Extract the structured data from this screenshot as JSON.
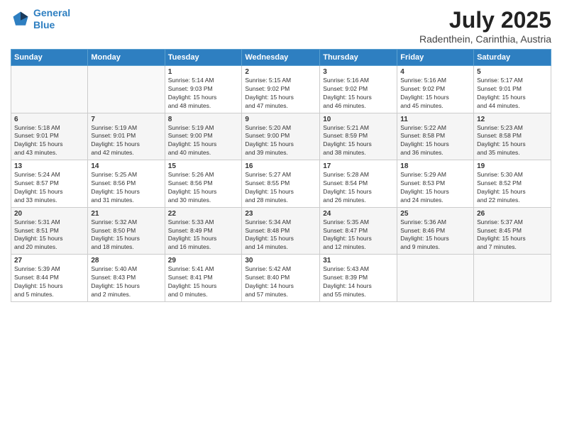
{
  "header": {
    "logo_line1": "General",
    "logo_line2": "Blue",
    "month": "July 2025",
    "location": "Radenthein, Carinthia, Austria"
  },
  "weekdays": [
    "Sunday",
    "Monday",
    "Tuesday",
    "Wednesday",
    "Thursday",
    "Friday",
    "Saturday"
  ],
  "weeks": [
    [
      {
        "day": "",
        "info": ""
      },
      {
        "day": "",
        "info": ""
      },
      {
        "day": "1",
        "info": "Sunrise: 5:14 AM\nSunset: 9:03 PM\nDaylight: 15 hours\nand 48 minutes."
      },
      {
        "day": "2",
        "info": "Sunrise: 5:15 AM\nSunset: 9:02 PM\nDaylight: 15 hours\nand 47 minutes."
      },
      {
        "day": "3",
        "info": "Sunrise: 5:16 AM\nSunset: 9:02 PM\nDaylight: 15 hours\nand 46 minutes."
      },
      {
        "day": "4",
        "info": "Sunrise: 5:16 AM\nSunset: 9:02 PM\nDaylight: 15 hours\nand 45 minutes."
      },
      {
        "day": "5",
        "info": "Sunrise: 5:17 AM\nSunset: 9:01 PM\nDaylight: 15 hours\nand 44 minutes."
      }
    ],
    [
      {
        "day": "6",
        "info": "Sunrise: 5:18 AM\nSunset: 9:01 PM\nDaylight: 15 hours\nand 43 minutes."
      },
      {
        "day": "7",
        "info": "Sunrise: 5:19 AM\nSunset: 9:01 PM\nDaylight: 15 hours\nand 42 minutes."
      },
      {
        "day": "8",
        "info": "Sunrise: 5:19 AM\nSunset: 9:00 PM\nDaylight: 15 hours\nand 40 minutes."
      },
      {
        "day": "9",
        "info": "Sunrise: 5:20 AM\nSunset: 9:00 PM\nDaylight: 15 hours\nand 39 minutes."
      },
      {
        "day": "10",
        "info": "Sunrise: 5:21 AM\nSunset: 8:59 PM\nDaylight: 15 hours\nand 38 minutes."
      },
      {
        "day": "11",
        "info": "Sunrise: 5:22 AM\nSunset: 8:58 PM\nDaylight: 15 hours\nand 36 minutes."
      },
      {
        "day": "12",
        "info": "Sunrise: 5:23 AM\nSunset: 8:58 PM\nDaylight: 15 hours\nand 35 minutes."
      }
    ],
    [
      {
        "day": "13",
        "info": "Sunrise: 5:24 AM\nSunset: 8:57 PM\nDaylight: 15 hours\nand 33 minutes."
      },
      {
        "day": "14",
        "info": "Sunrise: 5:25 AM\nSunset: 8:56 PM\nDaylight: 15 hours\nand 31 minutes."
      },
      {
        "day": "15",
        "info": "Sunrise: 5:26 AM\nSunset: 8:56 PM\nDaylight: 15 hours\nand 30 minutes."
      },
      {
        "day": "16",
        "info": "Sunrise: 5:27 AM\nSunset: 8:55 PM\nDaylight: 15 hours\nand 28 minutes."
      },
      {
        "day": "17",
        "info": "Sunrise: 5:28 AM\nSunset: 8:54 PM\nDaylight: 15 hours\nand 26 minutes."
      },
      {
        "day": "18",
        "info": "Sunrise: 5:29 AM\nSunset: 8:53 PM\nDaylight: 15 hours\nand 24 minutes."
      },
      {
        "day": "19",
        "info": "Sunrise: 5:30 AM\nSunset: 8:52 PM\nDaylight: 15 hours\nand 22 minutes."
      }
    ],
    [
      {
        "day": "20",
        "info": "Sunrise: 5:31 AM\nSunset: 8:51 PM\nDaylight: 15 hours\nand 20 minutes."
      },
      {
        "day": "21",
        "info": "Sunrise: 5:32 AM\nSunset: 8:50 PM\nDaylight: 15 hours\nand 18 minutes."
      },
      {
        "day": "22",
        "info": "Sunrise: 5:33 AM\nSunset: 8:49 PM\nDaylight: 15 hours\nand 16 minutes."
      },
      {
        "day": "23",
        "info": "Sunrise: 5:34 AM\nSunset: 8:48 PM\nDaylight: 15 hours\nand 14 minutes."
      },
      {
        "day": "24",
        "info": "Sunrise: 5:35 AM\nSunset: 8:47 PM\nDaylight: 15 hours\nand 12 minutes."
      },
      {
        "day": "25",
        "info": "Sunrise: 5:36 AM\nSunset: 8:46 PM\nDaylight: 15 hours\nand 9 minutes."
      },
      {
        "day": "26",
        "info": "Sunrise: 5:37 AM\nSunset: 8:45 PM\nDaylight: 15 hours\nand 7 minutes."
      }
    ],
    [
      {
        "day": "27",
        "info": "Sunrise: 5:39 AM\nSunset: 8:44 PM\nDaylight: 15 hours\nand 5 minutes."
      },
      {
        "day": "28",
        "info": "Sunrise: 5:40 AM\nSunset: 8:43 PM\nDaylight: 15 hours\nand 2 minutes."
      },
      {
        "day": "29",
        "info": "Sunrise: 5:41 AM\nSunset: 8:41 PM\nDaylight: 15 hours\nand 0 minutes."
      },
      {
        "day": "30",
        "info": "Sunrise: 5:42 AM\nSunset: 8:40 PM\nDaylight: 14 hours\nand 57 minutes."
      },
      {
        "day": "31",
        "info": "Sunrise: 5:43 AM\nSunset: 8:39 PM\nDaylight: 14 hours\nand 55 minutes."
      },
      {
        "day": "",
        "info": ""
      },
      {
        "day": "",
        "info": ""
      }
    ]
  ]
}
